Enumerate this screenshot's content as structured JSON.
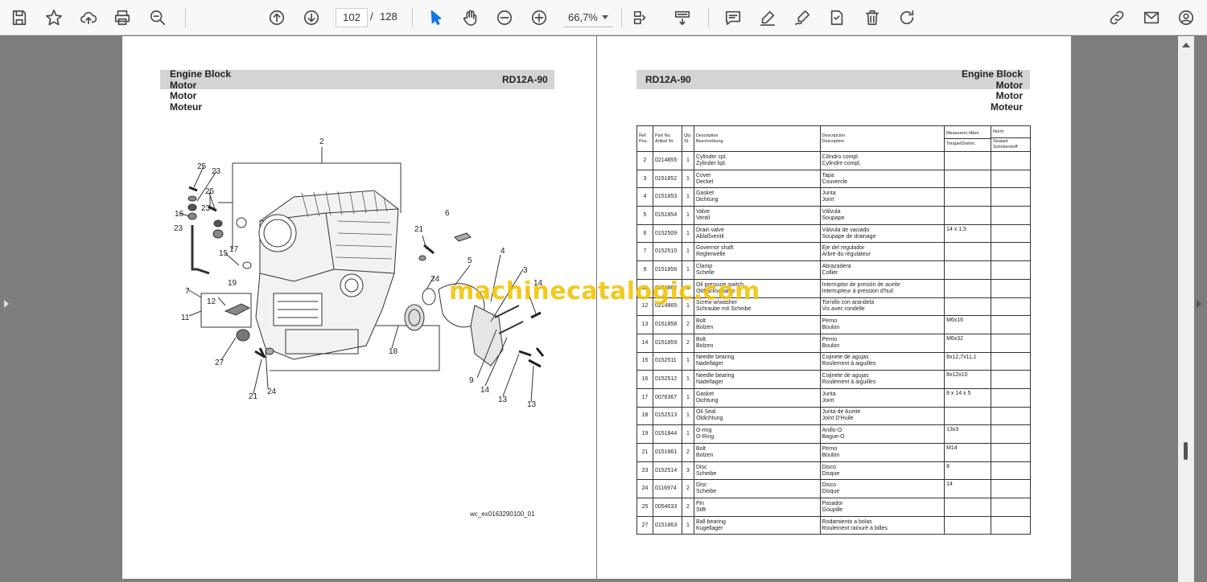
{
  "toolbar": {
    "page_current": "102",
    "page_separator": "/",
    "page_total": "128",
    "zoom": "66,7%",
    "icons": [
      "save-icon",
      "bookmark-star-icon",
      "upload-cloud-icon",
      "print-icon",
      "search-zoom-icon",
      "page-up-icon",
      "page-down-icon",
      "select-cursor-icon",
      "hand-pan-icon",
      "zoom-out-icon",
      "zoom-in-icon",
      "fit-page-icon",
      "scroll-mode-icon",
      "comment-icon",
      "highlight-pen-icon",
      "sign-icon",
      "stamp-icon",
      "delete-icon",
      "rotate-icon",
      "share-link-icon",
      "email-icon",
      "account-icon"
    ]
  },
  "left_page": {
    "header_lines": [
      "Engine Block",
      "Motor",
      "Motor",
      "Moteur"
    ],
    "model": "RD12A-90",
    "diagram_caption": "wc_ex0163290100_01",
    "callouts": [
      "2",
      "25",
      "23",
      "25",
      "16",
      "23",
      "23",
      "15",
      "17",
      "19",
      "7",
      "12",
      "11",
      "27",
      "21",
      "24",
      "18",
      "21",
      "24",
      "5",
      "4",
      "3",
      "6",
      "14",
      "9",
      "14",
      "13",
      "13"
    ]
  },
  "right_page": {
    "model": "RD12A-90",
    "header_lines": [
      "Engine Block",
      "Motor",
      "Motor",
      "Moteur"
    ],
    "table_headers": {
      "ref": [
        "Ref.",
        "Pos."
      ],
      "part": [
        "Part No.",
        "Artikel Nr."
      ],
      "qty": [
        "Qty.",
        "St."
      ],
      "desc_en": [
        "Description",
        "Beschreibung"
      ],
      "desc_es": [
        "Descripción",
        "Description"
      ],
      "measure_top": "Measurem./Abm.",
      "measure_bottom": "Torque/Drehm.",
      "norm_top": "Norm",
      "norm_bottom": [
        "Sealant",
        "Schmierstoff"
      ]
    },
    "rows": [
      {
        "ref": "2",
        "part": "0214855",
        "qty": "1",
        "en": [
          "Cylinder cpl.",
          "Zylinder kpl."
        ],
        "es": [
          "Cilindro compl.",
          "Cylindre compl."
        ],
        "meas": ""
      },
      {
        "ref": "3",
        "part": "0151852",
        "qty": "1",
        "en": [
          "Cover",
          "Deckel"
        ],
        "es": [
          "Tapa",
          "Couvercle"
        ],
        "meas": ""
      },
      {
        "ref": "4",
        "part": "0151853",
        "qty": "1",
        "en": [
          "Gasket",
          "Dichtung"
        ],
        "es": [
          "Junta",
          "Joint"
        ],
        "meas": ""
      },
      {
        "ref": "5",
        "part": "0151854",
        "qty": "1",
        "en": [
          "Valve",
          "Ventil"
        ],
        "es": [
          "Válvula",
          "Soupape"
        ],
        "meas": ""
      },
      {
        "ref": "6",
        "part": "0152509",
        "qty": "1",
        "en": [
          "Drain valve",
          "Ablaßventil"
        ],
        "es": [
          "Válvula de vaciado",
          "Soupape de drainage"
        ],
        "meas": "14 x 1,5"
      },
      {
        "ref": "7",
        "part": "0152510",
        "qty": "1",
        "en": [
          "Governor shaft",
          "Reglerwelle"
        ],
        "es": [
          "Eje del regulador",
          "Arbre du régulateur"
        ],
        "meas": ""
      },
      {
        "ref": "9",
        "part": "0151856",
        "qty": "1",
        "en": [
          "Clamp",
          "Schelle"
        ],
        "es": [
          "Abrazadera",
          "Collier"
        ],
        "meas": ""
      },
      {
        "ref": "11",
        "part": "0214862",
        "qty": "1",
        "en": [
          "Oil pressure switch",
          "Öldruckschalter"
        ],
        "es": [
          "Interruptor de presión de aceite",
          "Interrupteur à pression d'huil"
        ],
        "meas": ""
      },
      {
        "ref": "12",
        "part": "0214865",
        "qty": "1",
        "en": [
          "Screw w/washer",
          "Schraube mit Scheibe"
        ],
        "es": [
          "Tornillo con arandela",
          "Vis avec rondelle"
        ],
        "meas": ""
      },
      {
        "ref": "13",
        "part": "0151858",
        "qty": "2",
        "en": [
          "Bolt",
          "Bolzen"
        ],
        "es": [
          "Perno",
          "Boulon"
        ],
        "meas": "M6x16"
      },
      {
        "ref": "14",
        "part": "0151859",
        "qty": "2",
        "en": [
          "Bolt",
          "Bolzen"
        ],
        "es": [
          "Perno",
          "Boulon"
        ],
        "meas": "M6x32"
      },
      {
        "ref": "15",
        "part": "0152511",
        "qty": "1",
        "en": [
          "Needle bearing",
          "Nadellager"
        ],
        "es": [
          "Cojinete de agujas",
          "Roulement à aiguilles"
        ],
        "meas": "8x12,7x11,1"
      },
      {
        "ref": "16",
        "part": "0152512",
        "qty": "1",
        "en": [
          "Needle bearing",
          "Nadellager"
        ],
        "es": [
          "Cojinete de agujas",
          "Roulement à aiguilles"
        ],
        "meas": "8x12x10"
      },
      {
        "ref": "17",
        "part": "0076367",
        "qty": "1",
        "en": [
          "Gasket",
          "Dichtung"
        ],
        "es": [
          "Junta",
          "Joint"
        ],
        "meas": "8 x 14 x 5"
      },
      {
        "ref": "18",
        "part": "0152513",
        "qty": "1",
        "en": [
          "Oil Seal",
          "Öldichtung"
        ],
        "es": [
          "Junta de Aceite",
          "Joint D'Huile"
        ],
        "meas": ""
      },
      {
        "ref": "19",
        "part": "0151844",
        "qty": "1",
        "en": [
          "O-ring",
          "O-Ring"
        ],
        "es": [
          "Anillo-O",
          "Bague-O"
        ],
        "meas": "13x3"
      },
      {
        "ref": "21",
        "part": "0151861",
        "qty": "2",
        "en": [
          "Bolt",
          "Bolzen"
        ],
        "es": [
          "Perno",
          "Boulon"
        ],
        "meas": "M14"
      },
      {
        "ref": "23",
        "part": "0152514",
        "qty": "3",
        "en": [
          "Disc",
          "Scheibe"
        ],
        "es": [
          "Disco",
          "Disque"
        ],
        "meas": "8"
      },
      {
        "ref": "24",
        "part": "0116974",
        "qty": "2",
        "en": [
          "Disc",
          "Scheibe"
        ],
        "es": [
          "Disco",
          "Disque"
        ],
        "meas": "14"
      },
      {
        "ref": "25",
        "part": "0054033",
        "qty": "2",
        "en": [
          "Pin",
          "Stift"
        ],
        "es": [
          "Pasador",
          "Goupille"
        ],
        "meas": ""
      },
      {
        "ref": "27",
        "part": "0151863",
        "qty": "1",
        "en": [
          "Ball bearing",
          "Kugellager"
        ],
        "es": [
          "Rodamiento a bolas",
          "Roulement rainuré à billes"
        ],
        "meas": ""
      }
    ]
  },
  "watermark": "machinecatalogic.com"
}
